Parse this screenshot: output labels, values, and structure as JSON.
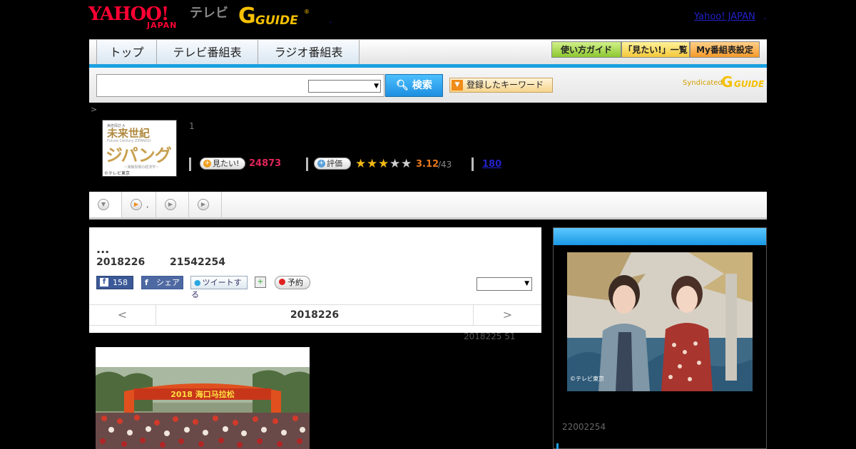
{
  "header": {
    "yahoo_logo": "YAHOO!",
    "yahoo_japan": "JAPAN",
    "tv_label": "テレビ",
    "gguide_logo": "G-GUIDE",
    "dot": ".",
    "yahoo_japan_link": "Yahoo! JAPAN",
    "link_dot": "."
  },
  "nav": {
    "tabs": [
      "トップ",
      "テレビ番組表",
      "ラジオ番組表"
    ],
    "buttons": [
      "使い方ガイド",
      "「見たい!」一覧",
      "My番組表設定"
    ]
  },
  "search": {
    "input_value": "",
    "select_value": "",
    "button_label": "検索",
    "keyword_button": "登録したキーワード",
    "syndicated": "Syndicated",
    "syndicated_logo": "G-GUIDE"
  },
  "breadcrumb": ">",
  "program": {
    "thumb_line1": "美術探訪 A",
    "thumb_title": "未来世紀",
    "thumb_sub": "Future Century ZIPANGU",
    "thumb_big": "ジパング",
    "thumb_caption": "~沸騰現場の経済学~",
    "thumb_credit": "©テレビ東京",
    "episode_number": "1",
    "mitai_label": "見たい!",
    "mitai_count": "24873",
    "rate_label": "評価",
    "stars_filled": 3,
    "stars_total": 5,
    "rating": "3.12",
    "rating_count": "/43",
    "review_count": "180"
  },
  "subtabs": {
    "dot": ","
  },
  "main": {
    "title": "...",
    "date": "2018226",
    "time": "21542254",
    "fb_like_count": "158",
    "fb_share": "シェア",
    "tweet": "ツイートする",
    "reserve": "予約",
    "select_value": "",
    "prev": "<",
    "current_date": "2018226",
    "next": ">"
  },
  "updated": "2018225  51",
  "photo": {
    "banner_text": "2018 海口马拉松"
  },
  "side": {
    "image_credit": "©テレビ東京",
    "time": "22002254"
  },
  "colors": {
    "accent_blue": "#1aa0e0",
    "mitai_red": "#e0245a",
    "rating_orange": "#e8781a",
    "star_gold": "#f0b818"
  }
}
